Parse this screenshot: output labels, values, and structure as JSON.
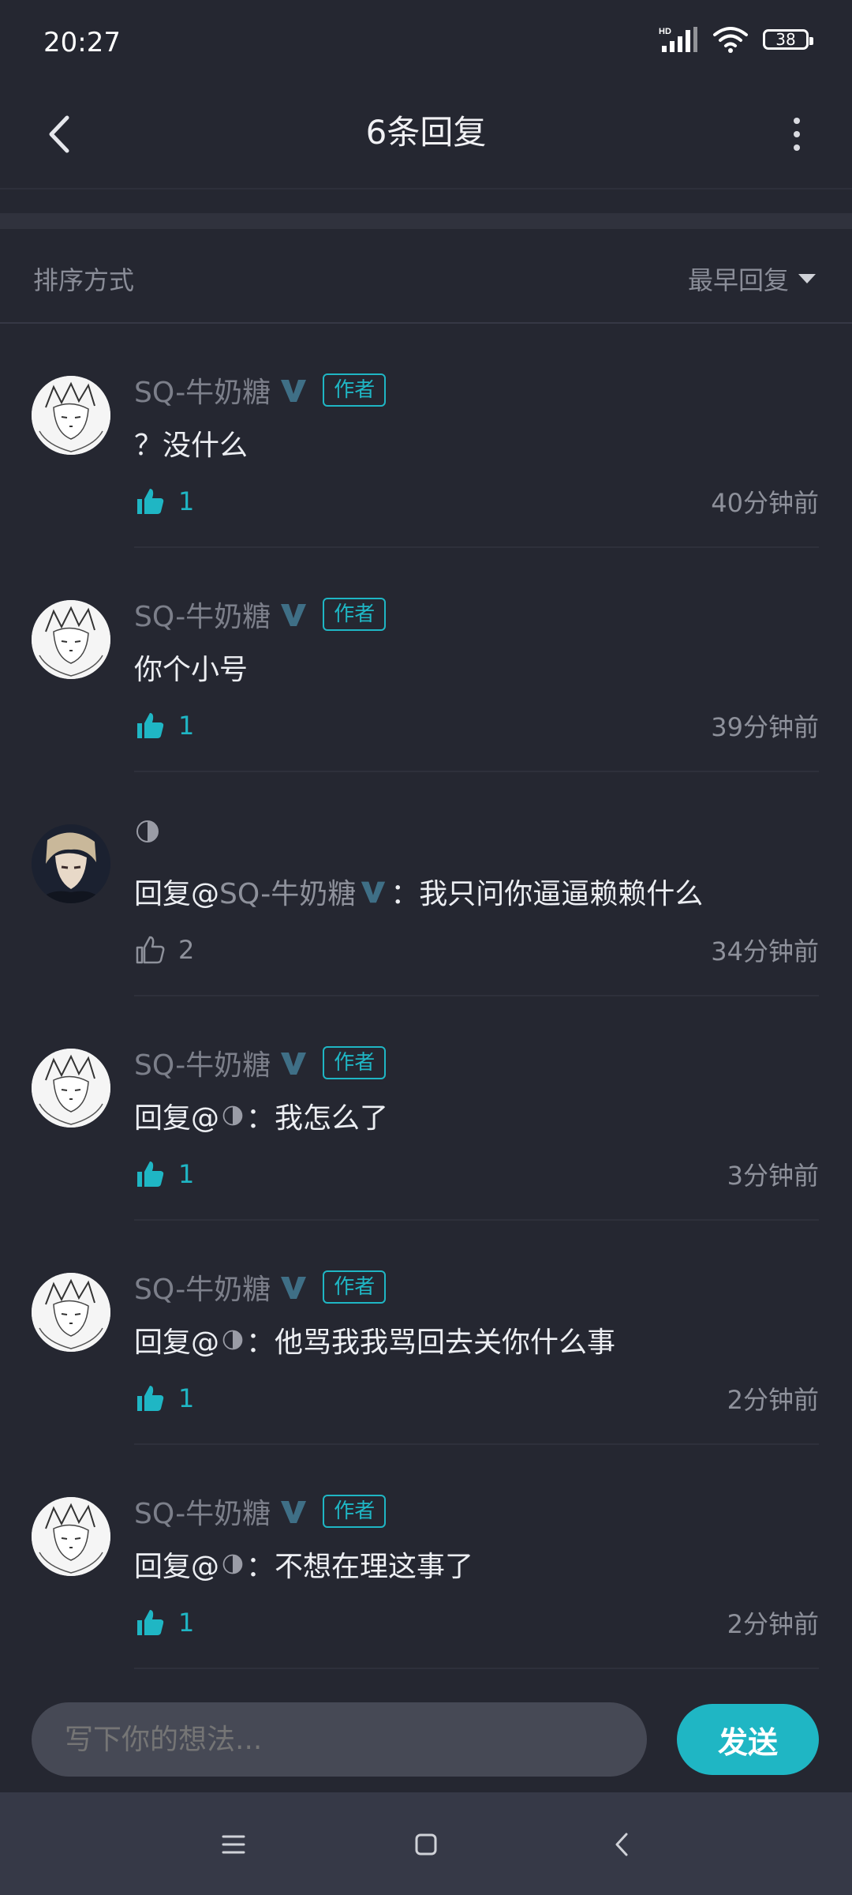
{
  "status_bar": {
    "time": "20:27",
    "battery": "38",
    "network_label": "HD"
  },
  "header": {
    "title": "6条回复"
  },
  "sort": {
    "label": "排序方式",
    "selected": "最早回复"
  },
  "replies": [
    {
      "username": "SQ-牛奶糖",
      "tag": "作者",
      "content": "？没什么",
      "likes": "1",
      "liked": true,
      "time": "40分钟前"
    },
    {
      "username": "SQ-牛奶糖",
      "tag": "作者",
      "content": "你个小号",
      "likes": "1",
      "liked": true,
      "time": "39分钟前"
    },
    {
      "username": "",
      "tag": "",
      "reply_prefix": "回复@",
      "reply_target": "SQ-牛奶糖",
      "reply_sep": "：",
      "content": "我只问你逼逼赖赖什么",
      "likes": "2",
      "liked": false,
      "time": "34分钟前"
    },
    {
      "username": "SQ-牛奶糖",
      "tag": "作者",
      "reply_prefix": "回复@",
      "reply_sep": "：",
      "content": "我怎么了",
      "likes": "1",
      "liked": true,
      "time": "3分钟前"
    },
    {
      "username": "SQ-牛奶糖",
      "tag": "作者",
      "reply_prefix": "回复@",
      "reply_sep": "：",
      "content": "他骂我我骂回去关你什么事",
      "likes": "1",
      "liked": true,
      "time": "2分钟前"
    },
    {
      "username": "SQ-牛奶糖",
      "tag": "作者",
      "reply_prefix": "回复@",
      "reply_sep": "：",
      "content": "不想在理这事了",
      "likes": "1",
      "liked": true,
      "time": "2分钟前"
    }
  ],
  "composer": {
    "placeholder": "写下你的想法...",
    "send_label": "发送"
  },
  "colors": {
    "accent": "#1fb6c4",
    "background": "#252731",
    "verified_badge": "#3f6f86"
  },
  "icons": {
    "back": "chevron-left-icon",
    "more": "more-vertical-icon",
    "like": "thumbs-up-icon",
    "verified": "verified-v-icon"
  }
}
